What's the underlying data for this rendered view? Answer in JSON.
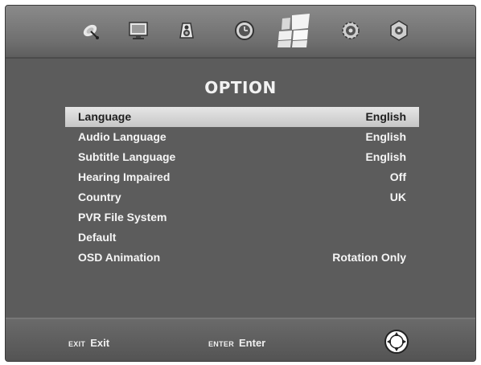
{
  "menu": {
    "title": "OPTION",
    "items": [
      {
        "label": "Language",
        "value": "English"
      },
      {
        "label": "Audio Language",
        "value": "English"
      },
      {
        "label": "Subtitle Language",
        "value": "English"
      },
      {
        "label": "Hearing Impaired",
        "value": "Off"
      },
      {
        "label": "Country",
        "value": "UK"
      },
      {
        "label": "PVR File System",
        "value": ""
      },
      {
        "label": "Default",
        "value": ""
      },
      {
        "label": "OSD Animation",
        "value": "Rotation Only"
      }
    ]
  },
  "top_icons": [
    "satellite-dish-icon",
    "monitor-icon",
    "audio-speaker-icon",
    "clock-icon",
    "option-tiles-icon",
    "settings-gear-icon",
    "system-icon"
  ],
  "footer": {
    "exit_key": "EXIT",
    "exit_label": "Exit",
    "enter_key": "ENTER",
    "enter_label": "Enter"
  },
  "colors": {
    "highlight": "#d4d4d4",
    "background": "#5c5c5c"
  }
}
